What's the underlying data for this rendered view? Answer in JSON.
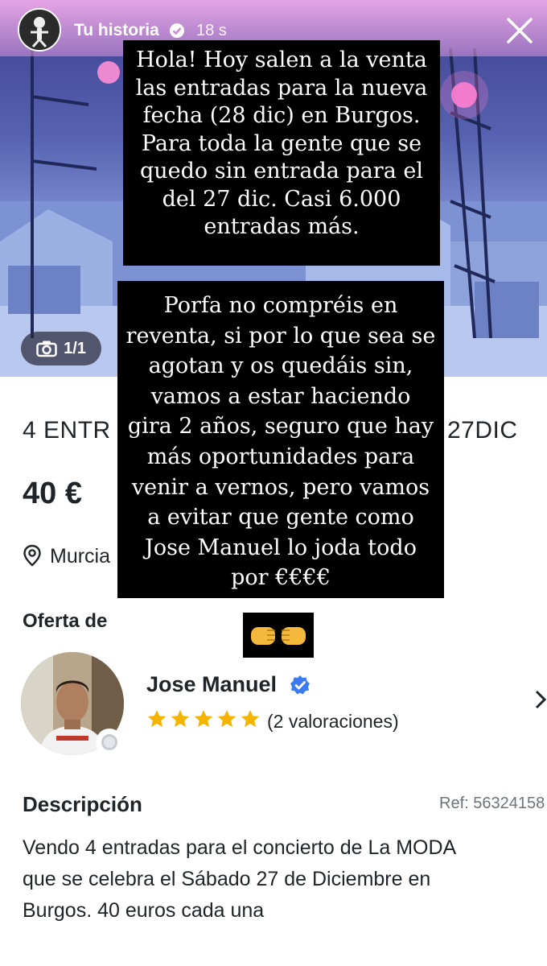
{
  "story": {
    "title": "Tu historia",
    "time": "18 s",
    "verified_icon": "verified-badge-icon",
    "close_icon": "close-icon"
  },
  "listing": {
    "photo_counter": "1/1",
    "title_left": "4 ENTR",
    "title_right": "27DIC",
    "price": "40 €",
    "location": "Murcia",
    "offer_label": "Oferta de",
    "seller_name": "Jose Manuel",
    "rating_stars": 5,
    "ratings": "(2 valoraciones)",
    "description_label": "Descripción",
    "ref": "Ref: 56324158",
    "description_lines": [
      "Vendo 4 entradas para el concierto de La MODA",
      "que se celebra el Sábado 27 de Diciembre en",
      "Burgos. 40 euros cada una"
    ]
  },
  "overlay": {
    "box1_lines": [
      "Hola! Hoy salen a la venta",
      "las entradas para la nueva",
      "fecha (28 dic) en Burgos.",
      "Para toda la gente que se",
      "quedo sin entrada para el",
      "del 27 dic. Casi 6.000",
      "entradas más."
    ],
    "box2_lines": [
      "Porfa no compréis en",
      "reventa, si por lo que sea se",
      "agotan y os quedáis sin,",
      "vamos a estar haciendo",
      "gira 2 años, seguro que hay",
      "más oportunidades para",
      "venir a vernos, pero vamos",
      "a evitar que gente como",
      "Jose Manuel lo joda todo",
      "por €€€€"
    ],
    "emoji": "🤜🤛"
  },
  "colors": {
    "header_pink": "#e9a8e6",
    "star_gold": "#f5b400",
    "verified_blue": "#3b7bf0",
    "text_dark": "#1e2428"
  }
}
